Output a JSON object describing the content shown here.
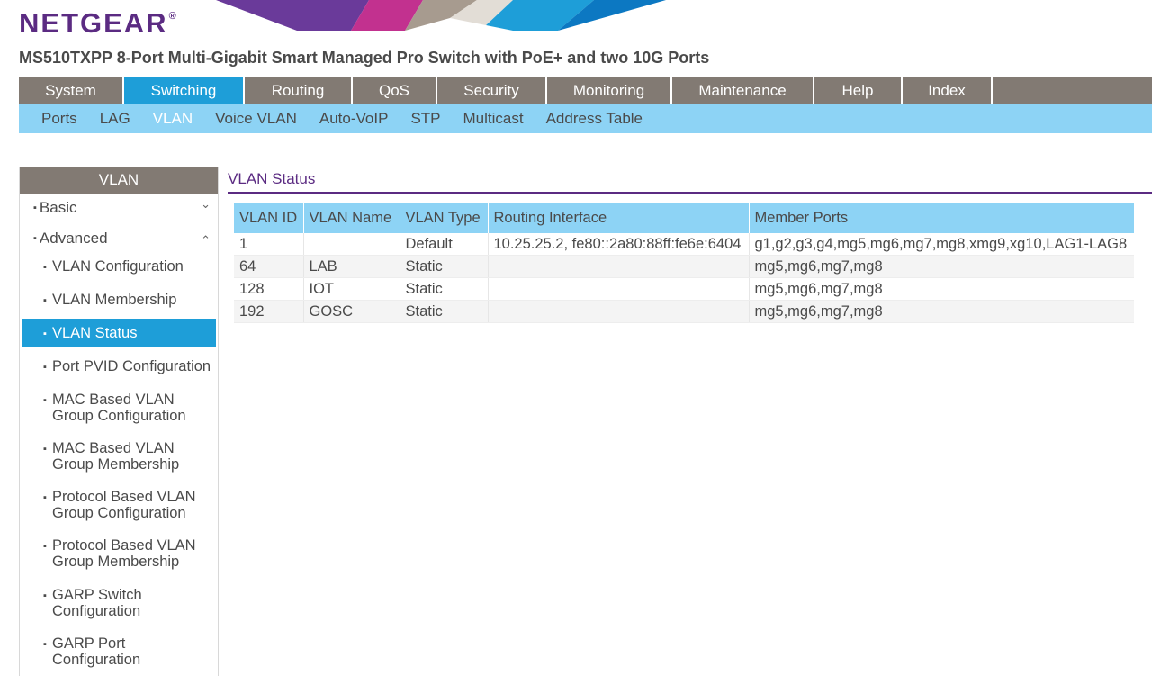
{
  "brand": {
    "logo_text": "NETGEAR",
    "registered_mark": "®"
  },
  "product_title": "MS510TXPP 8-Port Multi-Gigabit Smart Managed Pro Switch with PoE+ and two 10G Ports",
  "main_nav": {
    "tabs": [
      {
        "label": "System"
      },
      {
        "label": "Switching"
      },
      {
        "label": "Routing"
      },
      {
        "label": "QoS"
      },
      {
        "label": "Security"
      },
      {
        "label": "Monitoring"
      },
      {
        "label": "Maintenance"
      },
      {
        "label": "Help"
      },
      {
        "label": "Index"
      }
    ],
    "active": "Switching"
  },
  "sub_nav": {
    "items": [
      {
        "label": "Ports"
      },
      {
        "label": "LAG"
      },
      {
        "label": "VLAN"
      },
      {
        "label": "Voice VLAN"
      },
      {
        "label": "Auto-VoIP"
      },
      {
        "label": "STP"
      },
      {
        "label": "Multicast"
      },
      {
        "label": "Address Table"
      }
    ],
    "active": "VLAN"
  },
  "sidebar": {
    "title": "VLAN",
    "groups": [
      {
        "label": "Basic",
        "expanded": false
      },
      {
        "label": "Advanced",
        "expanded": true
      }
    ],
    "items": [
      {
        "label": "VLAN Configuration"
      },
      {
        "label": "VLAN Membership"
      },
      {
        "label": "VLAN Status"
      },
      {
        "label": "Port PVID Configuration"
      },
      {
        "label": "MAC Based VLAN Group Configuration"
      },
      {
        "label": "MAC Based VLAN Group Membership"
      },
      {
        "label": "Protocol Based VLAN Group Configuration"
      },
      {
        "label": "Protocol Based VLAN Group Membership"
      },
      {
        "label": "GARP Switch Configuration"
      },
      {
        "label": "GARP Port Configuration"
      }
    ],
    "active": "VLAN Status"
  },
  "content": {
    "tab_label": "VLAN Status",
    "table": {
      "headers": [
        "VLAN ID",
        "VLAN Name",
        "VLAN Type",
        "Routing Interface",
        "Member Ports"
      ],
      "rows": [
        [
          "1",
          "",
          "Default",
          "10.25.25.2, fe80::2a80:88ff:fe6e:6404",
          "g1,g2,g3,g4,mg5,mg6,mg7,mg8,xmg9,xg10,LAG1-LAG8"
        ],
        [
          "64",
          "LAB",
          "Static",
          "",
          "mg5,mg6,mg7,mg8"
        ],
        [
          "128",
          "IOT",
          "Static",
          "",
          "mg5,mg6,mg7,mg8"
        ],
        [
          "192",
          "GOSC",
          "Static",
          "",
          "mg5,mg6,mg7,mg8"
        ]
      ]
    }
  },
  "colors": {
    "brand_purple": "#5b2b82",
    "nav_gray": "#827a73",
    "active_blue": "#1e9ed8",
    "light_blue": "#8dd3f5"
  }
}
